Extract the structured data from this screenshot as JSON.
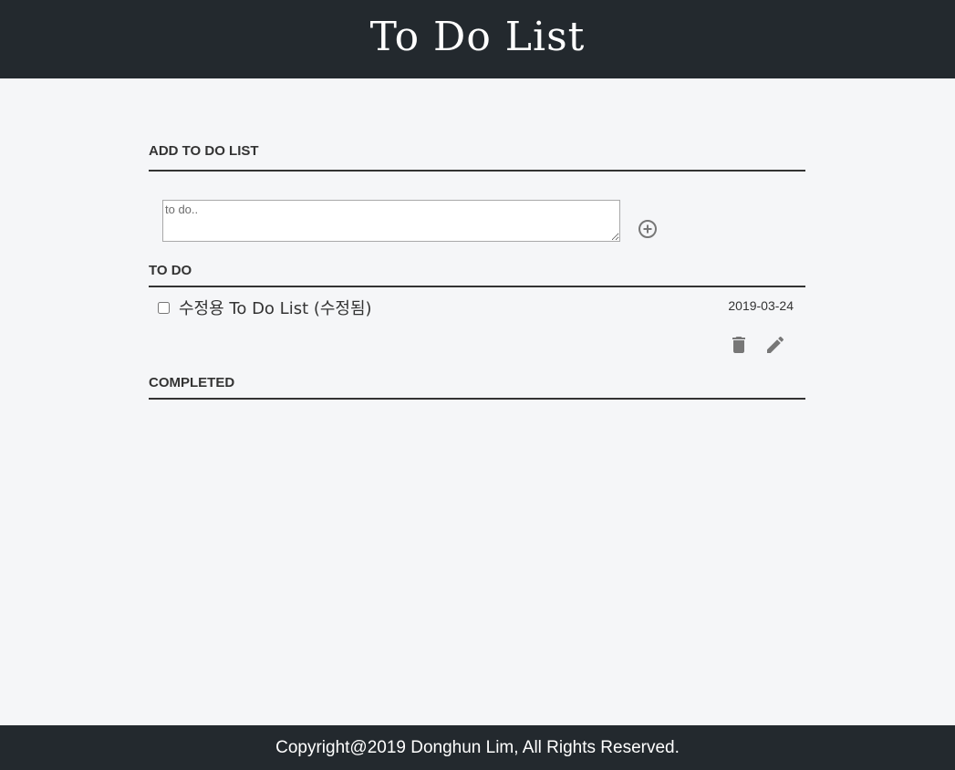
{
  "header": {
    "title": "To Do List"
  },
  "add_section": {
    "title": "ADD TO DO LIST",
    "input_placeholder": "to do..",
    "input_value": "",
    "add_icon": "plus-circle-icon"
  },
  "todo_section": {
    "title": "TO DO",
    "items": [
      {
        "text": "수정용 To Do List (수정됨)",
        "date": "2019-03-24",
        "checked": false,
        "delete_icon": "trash-icon",
        "edit_icon": "pencil-icon"
      }
    ]
  },
  "completed_section": {
    "title": "COMPLETED",
    "items": []
  },
  "footer": {
    "text": "Copyright@2019 Donghun Lim, All Rights Reserved."
  },
  "colors": {
    "header_bg": "#23292e",
    "page_bg": "#f5f6f8",
    "rule": "#333333",
    "icon": "#777777"
  }
}
